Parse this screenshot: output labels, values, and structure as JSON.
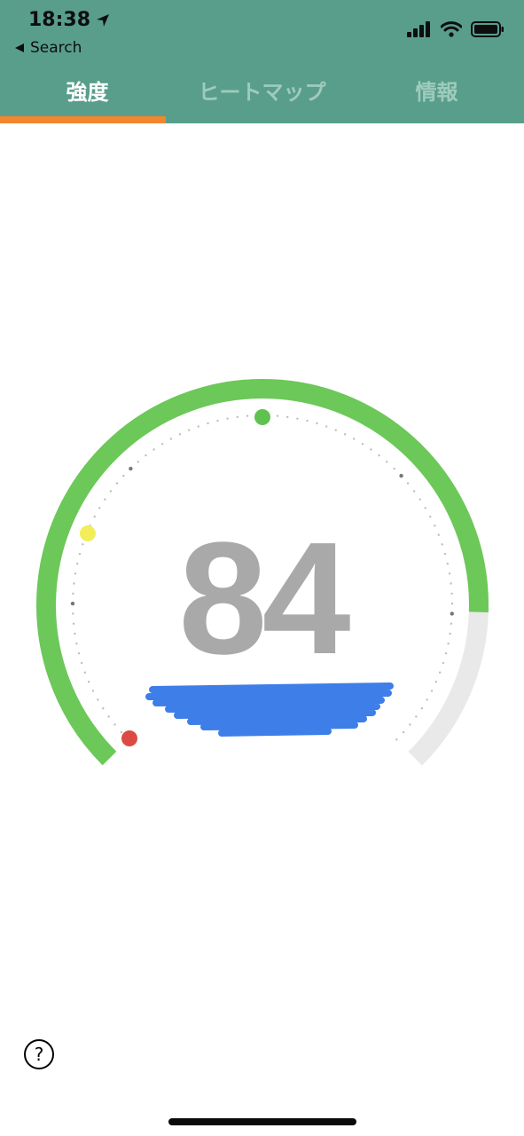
{
  "status_bar": {
    "time": "18:38",
    "back_label": "Search"
  },
  "tabs": [
    {
      "label": "強度",
      "active": true
    },
    {
      "label": "ヒートマップ",
      "active": false
    },
    {
      "label": "情報",
      "active": false
    }
  ],
  "gauge": {
    "value": "84",
    "level_percent": 84,
    "colors": {
      "accent": "#6cc858",
      "track": "#f3f3f3",
      "marker_good": "#5fc24f",
      "marker_warn": "#f2ee5a",
      "marker_bad": "#dc4b43"
    }
  },
  "icons": {
    "help": "question-icon",
    "location": "location-arrow-icon",
    "signal": "cellular-signal-icon",
    "wifi": "wifi-icon",
    "battery": "battery-icon"
  },
  "help_symbol": "?"
}
